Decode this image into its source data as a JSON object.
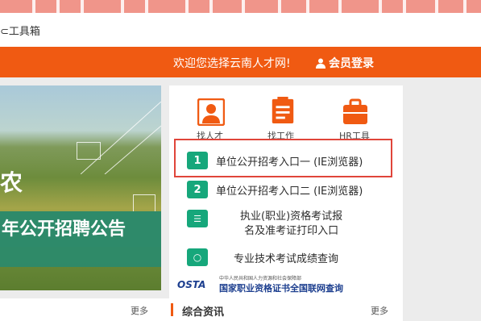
{
  "topbar": {
    "tools_label": "工具箱",
    "tools_label_partial": "⊂工具箱"
  },
  "header": {
    "welcome": "欢迎您选择云南人才网!",
    "login": "会员登录"
  },
  "banner": {
    "title_fragment": "农",
    "headline": "年公开招聘公告"
  },
  "quick_links": [
    {
      "label": "找人才",
      "icon": "person-card-icon"
    },
    {
      "label": "找工作",
      "icon": "clipboard-icon"
    },
    {
      "label": "HR工具",
      "icon": "briefcase-icon"
    }
  ],
  "entries": [
    {
      "badge": "1",
      "label": "单位公开招考入口一 (IE浏览器)"
    },
    {
      "badge": "2",
      "label": "单位公开招考入口二 (IE浏览器)"
    }
  ],
  "exam_print": {
    "line1": "执业(职业)资格考试报",
    "line2": "名及准考证打印入口"
  },
  "score_query": {
    "label": "专业技术考试成绩查询"
  },
  "csta": {
    "logo": "OSTA",
    "line1": "中华人民共和国人力资源和社会保障部",
    "line2": "国家职业资格证书全国联网查询"
  },
  "footer": {
    "more_left": "更多",
    "section_title": "综合资讯",
    "more_right": "更多"
  },
  "colors": {
    "orange": "#f05a12",
    "green": "#16a77b",
    "highlight_red": "#e0453a"
  }
}
